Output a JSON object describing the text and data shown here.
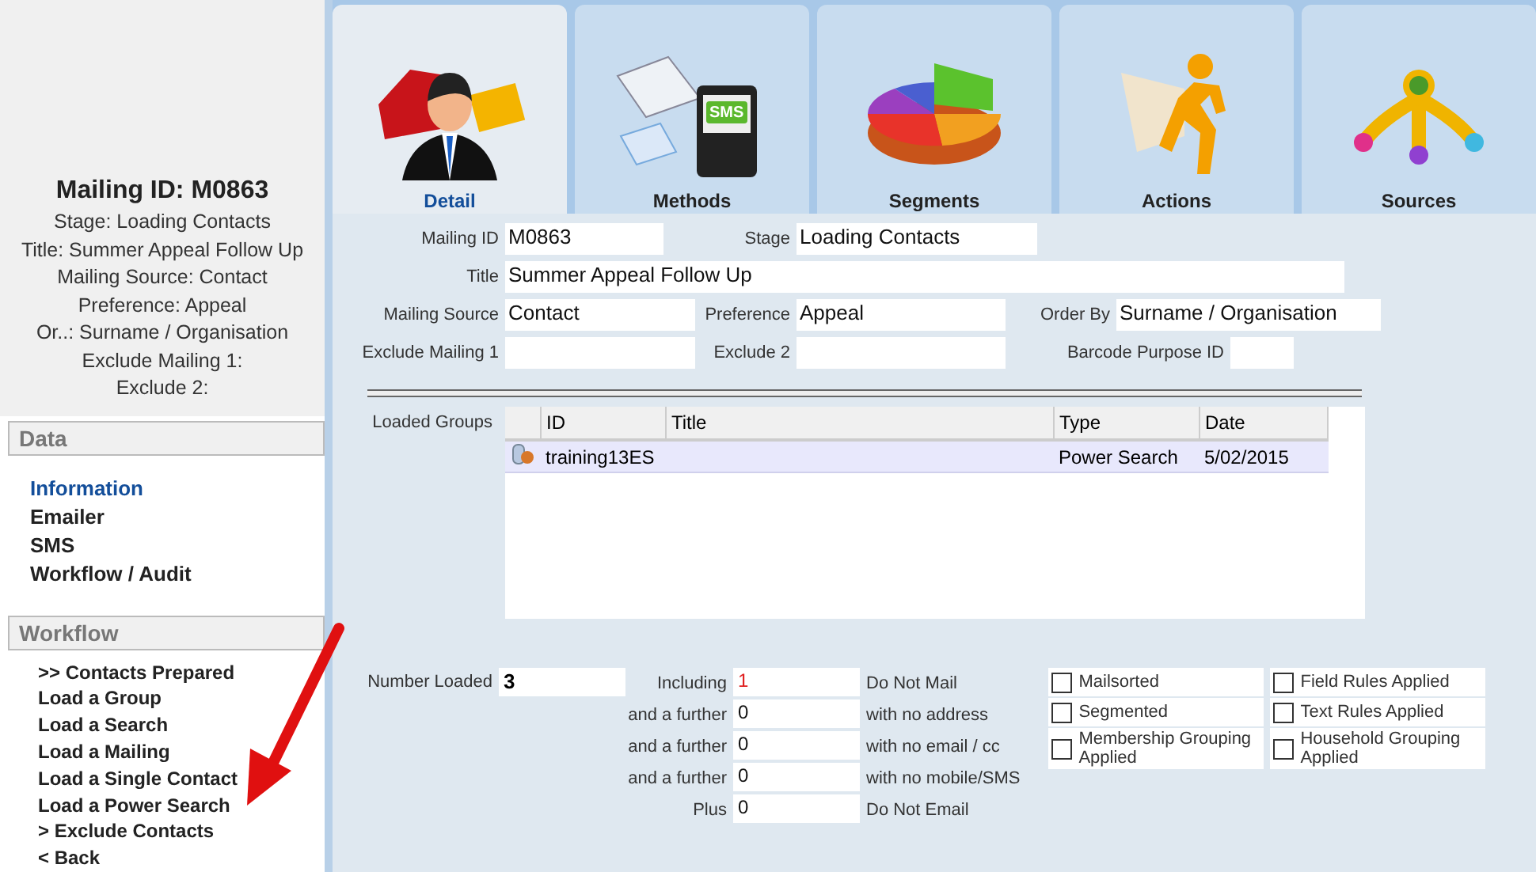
{
  "summary": {
    "heading": "Mailing ID: M0863",
    "lines": [
      "Stage: Loading Contacts",
      "Title: Summer Appeal Follow Up",
      "Mailing Source: Contact",
      "Preference: Appeal",
      "Or..: Surname / Organisation",
      "Exclude Mailing 1:",
      "Exclude 2:"
    ]
  },
  "data_menu": {
    "title": "Data",
    "items": [
      {
        "label": "Information",
        "selected": true
      },
      {
        "label": "Emailer",
        "selected": false
      },
      {
        "label": "SMS",
        "selected": false
      },
      {
        "label": "Workflow / Audit",
        "selected": false
      }
    ]
  },
  "workflow_menu": {
    "title": "Workflow",
    "items": [
      ">> Contacts Prepared",
      "Load a Group",
      "Load a Search",
      "Load a Mailing",
      "Load a Single Contact",
      "Load a Power Search",
      "> Exclude Contacts",
      "< Back"
    ]
  },
  "tabs": [
    {
      "label": "Detail",
      "kind": "detail",
      "selected": true
    },
    {
      "label": "Methods",
      "kind": "methods",
      "selected": false,
      "icon_text": "SMS"
    },
    {
      "label": "Segments",
      "kind": "segments",
      "selected": false
    },
    {
      "label": "Actions",
      "kind": "actions",
      "selected": false
    },
    {
      "label": "Sources",
      "kind": "sources",
      "selected": false
    }
  ],
  "form": {
    "mailing_id": {
      "label": "Mailing ID",
      "value": "M0863"
    },
    "stage": {
      "label": "Stage",
      "value": "Loading Contacts"
    },
    "title": {
      "label": "Title",
      "value": "Summer Appeal Follow Up"
    },
    "mailing_source": {
      "label": "Mailing Source",
      "value": "Contact"
    },
    "preference": {
      "label": "Preference",
      "value": "Appeal"
    },
    "order_by": {
      "label": "Order By",
      "value": "Surname / Organisation"
    },
    "exclude_mailing_1": {
      "label": "Exclude Mailing 1"
    },
    "exclude_2": {
      "label": "Exclude 2"
    },
    "barcode_purpose_id": {
      "label": "Barcode Purpose ID"
    }
  },
  "loaded_groups": {
    "label": "Loaded Groups",
    "columns": [
      "ID",
      "Title",
      "Type",
      "Date"
    ],
    "rows": [
      {
        "id": "training13ES",
        "type": "Power Search",
        "date": "5/02/2015",
        "selected": true
      }
    ]
  },
  "counts": {
    "number_loaded": {
      "label": "Number Loaded",
      "value": "3"
    },
    "rows": [
      {
        "label": "Including",
        "value": "1",
        "note": "Do Not Mail",
        "highlight": true
      },
      {
        "label": "and a further",
        "value": "0",
        "note": "with no address",
        "highlight": false
      },
      {
        "label": "and a further",
        "value": "0",
        "note": "with no email / cc",
        "highlight": false
      },
      {
        "label": "and a further",
        "value": "0",
        "note": "with no mobile/SMS",
        "highlight": false
      },
      {
        "label": "Plus",
        "value": "0",
        "note": "Do Not Email",
        "highlight": false
      }
    ]
  },
  "flags": [
    {
      "label": "Mailsorted",
      "checked": false
    },
    {
      "label": "Field Rules Applied",
      "checked": false
    },
    {
      "label": "Segmented",
      "checked": false
    },
    {
      "label": "Text Rules Applied",
      "checked": false
    },
    {
      "label": "Membership Grouping Applied",
      "checked": false
    },
    {
      "label": "Household Grouping Applied",
      "checked": false
    }
  ]
}
